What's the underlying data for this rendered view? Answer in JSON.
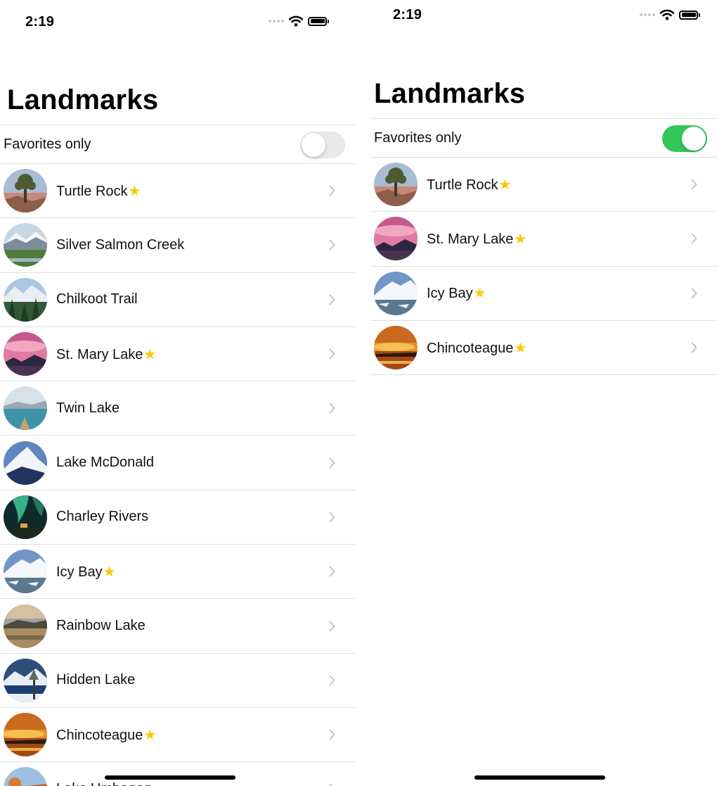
{
  "colors": {
    "star": "#ffc800",
    "toggle_on": "#34c759",
    "toggle_off": "#e9e9eb"
  },
  "screens": [
    {
      "status_bar": {
        "time": "2:19",
        "icons": [
          "signal-dots-icon",
          "wifi-icon",
          "battery-icon"
        ]
      },
      "title": "Landmarks",
      "favorites_toggle": {
        "label": "Favorites only",
        "state": "off"
      },
      "landmarks": [
        {
          "name": "Turtle Rock",
          "favorite": true,
          "star": "★",
          "image": "turtle-rock"
        },
        {
          "name": "Silver Salmon Creek",
          "favorite": false,
          "star": "",
          "image": "silver-salmon-creek"
        },
        {
          "name": "Chilkoot Trail",
          "favorite": false,
          "star": "",
          "image": "chilkoot-trail"
        },
        {
          "name": "St. Mary Lake",
          "favorite": true,
          "star": "★",
          "image": "st-mary-lake"
        },
        {
          "name": "Twin Lake",
          "favorite": false,
          "star": "",
          "image": "twin-lake"
        },
        {
          "name": "Lake McDonald",
          "favorite": false,
          "star": "",
          "image": "lake-mcdonald"
        },
        {
          "name": "Charley Rivers",
          "favorite": false,
          "star": "",
          "image": "charley-rivers"
        },
        {
          "name": "Icy Bay",
          "favorite": true,
          "star": "★",
          "image": "icy-bay"
        },
        {
          "name": "Rainbow Lake",
          "favorite": false,
          "star": "",
          "image": "rainbow-lake"
        },
        {
          "name": "Hidden Lake",
          "favorite": false,
          "star": "",
          "image": "hidden-lake"
        },
        {
          "name": "Chincoteague",
          "favorite": true,
          "star": "★",
          "image": "chincoteague"
        },
        {
          "name": "Lake Umbagog",
          "favorite": false,
          "star": "",
          "image": "lake-umbagog"
        }
      ]
    },
    {
      "status_bar": {
        "time": "2:19",
        "icons": [
          "signal-dots-icon",
          "wifi-icon",
          "battery-icon"
        ]
      },
      "title": "Landmarks",
      "favorites_toggle": {
        "label": "Favorites only",
        "state": "on"
      },
      "landmarks": [
        {
          "name": "Turtle Rock",
          "favorite": true,
          "star": "★",
          "image": "turtle-rock"
        },
        {
          "name": "St. Mary Lake",
          "favorite": true,
          "star": "★",
          "image": "st-mary-lake"
        },
        {
          "name": "Icy Bay",
          "favorite": true,
          "star": "★",
          "image": "icy-bay"
        },
        {
          "name": "Chincoteague",
          "favorite": true,
          "star": "★",
          "image": "chincoteague"
        }
      ]
    }
  ]
}
